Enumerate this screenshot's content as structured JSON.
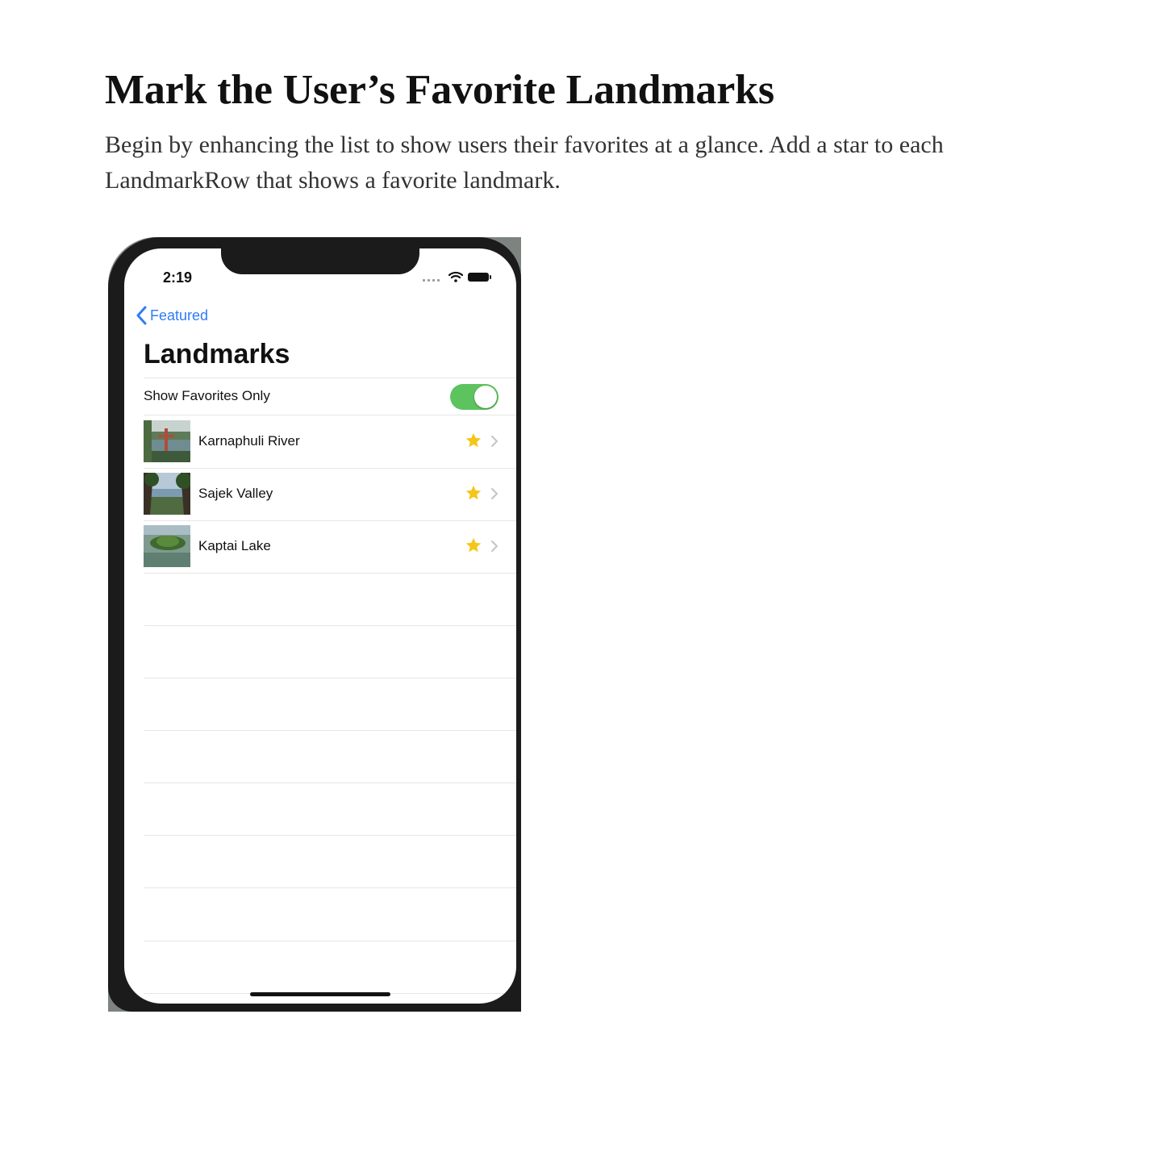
{
  "doc": {
    "title": "Mark the User’s Favorite Landmarks",
    "body": "Begin by enhancing the list to show users their favorites at a glance. Add a star to each LandmarkRow that shows a favorite landmark."
  },
  "phone": {
    "status_time": "2:19",
    "back_label": "Featured",
    "nav_title": "Landmarks",
    "toggle": {
      "label": "Show Favorites Only",
      "on": true
    },
    "rows": [
      {
        "name": "Karnaphuli River",
        "favorite": true
      },
      {
        "name": "Sajek Valley",
        "favorite": true
      },
      {
        "name": "Kaptai Lake",
        "favorite": true
      }
    ],
    "colors": {
      "accent": "#2f7cf6",
      "toggle_on": "#5dc35e",
      "star": "#f5c518"
    }
  }
}
